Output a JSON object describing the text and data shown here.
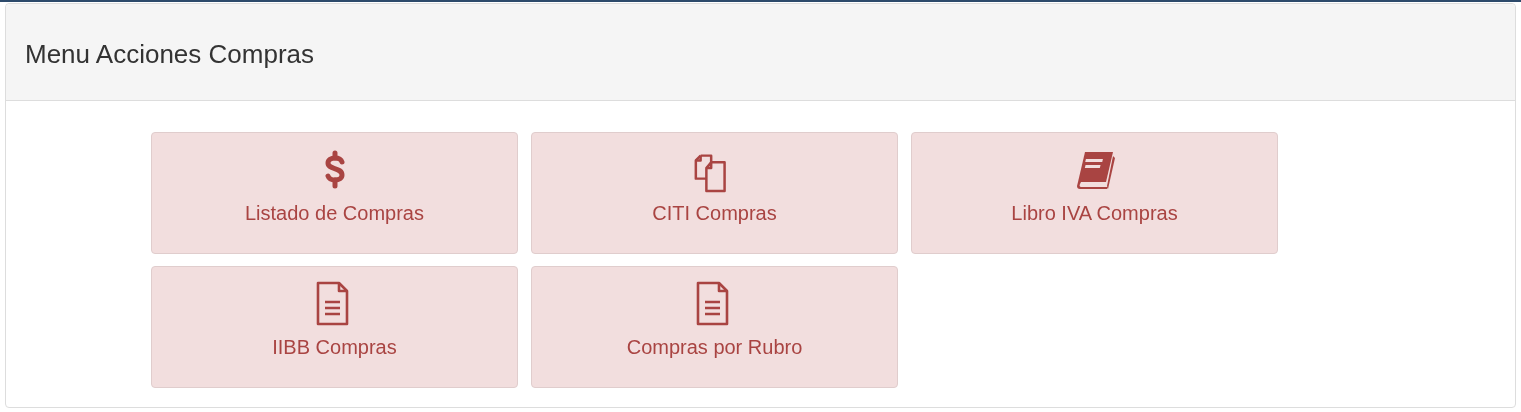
{
  "panel": {
    "title": "Menu Acciones Compras"
  },
  "actions": [
    {
      "label": "Listado de Compras",
      "kind": "dollar"
    },
    {
      "label": "CITI Compras",
      "kind": "files"
    },
    {
      "label": "Libro IVA Compras",
      "kind": "book"
    },
    {
      "label": "IIBB Compras",
      "kind": "document"
    },
    {
      "label": "Compras por Rubro",
      "kind": "document"
    }
  ]
}
